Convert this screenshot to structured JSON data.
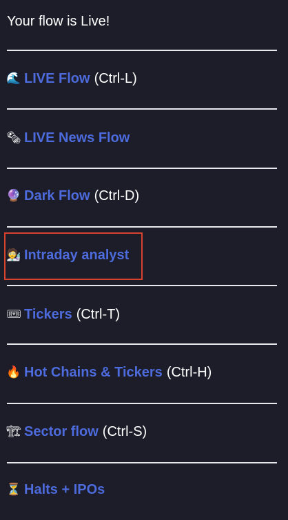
{
  "header": {
    "title": "Your flow is Live!"
  },
  "menu": {
    "items": [
      {
        "icon": "🌊",
        "icon_name": "wave-icon",
        "label": "LIVE Flow",
        "shortcut": "(Ctrl-L)"
      },
      {
        "icon": "🗞",
        "icon_name": "newspaper-icon",
        "label": "LIVE News Flow",
        "shortcut": ""
      },
      {
        "icon": "🔮",
        "icon_name": "crystal-ball-icon",
        "label": "Dark Flow",
        "shortcut": "(Ctrl-D)"
      },
      {
        "icon": "🧑‍🔬",
        "icon_name": "analyst-icon",
        "label": "Intraday analyst",
        "shortcut": ""
      },
      {
        "icon": "🎟",
        "icon_name": "ticket-icon",
        "label": "Tickers",
        "shortcut": "(Ctrl-T)"
      },
      {
        "icon": "🔥",
        "icon_name": "fire-icon",
        "label": "Hot Chains & Tickers",
        "shortcut": "(Ctrl-H)"
      },
      {
        "icon": "🏗",
        "icon_name": "crane-icon",
        "label": "Sector flow",
        "shortcut": "(Ctrl-S)"
      },
      {
        "icon": "⏳",
        "icon_name": "hourglass-icon",
        "label": "Halts + IPOs",
        "shortcut": ""
      }
    ]
  },
  "colors": {
    "background": "#1c1d28",
    "link": "#4d6bdc",
    "text": "#ffffff",
    "divider": "#e9e9ee",
    "highlight": "#d8432f"
  }
}
